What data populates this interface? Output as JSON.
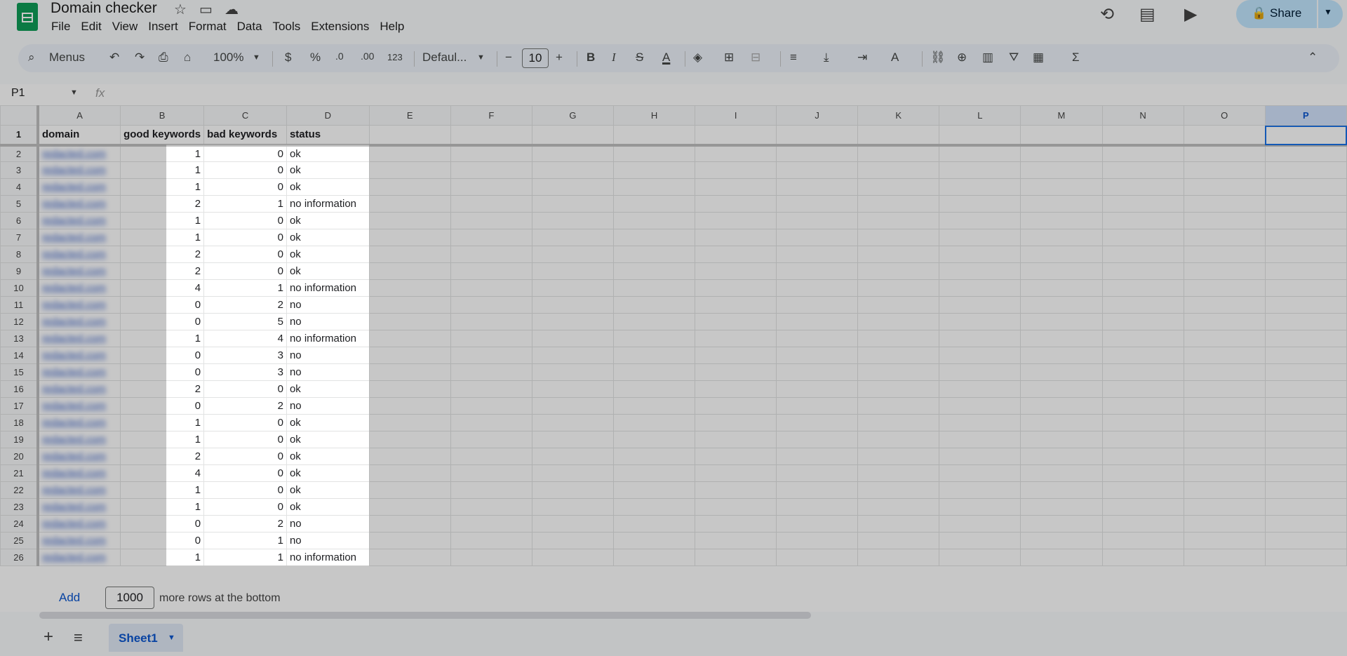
{
  "doc": {
    "title": "Domain checker",
    "star_icon": "star-icon",
    "move_icon": "folder-move-icon",
    "cloud_icon": "cloud-status-icon"
  },
  "menu": [
    "File",
    "Edit",
    "View",
    "Insert",
    "Format",
    "Data",
    "Tools",
    "Extensions",
    "Help"
  ],
  "header_right": {
    "history_icon": "history-icon",
    "comments_icon": "comments-icon",
    "meet_icon": "video-call-icon",
    "share_label": "Share"
  },
  "toolbar": {
    "search_label": "Menus",
    "zoom": "100%",
    "currency": "$",
    "percent": "%",
    "dec_decrease": ".0",
    "dec_increase": ".00",
    "number_format": "123",
    "font": "Defaul...",
    "font_size": "10",
    "bold": "B",
    "italic": "I",
    "strike": "S",
    "text_color": "A",
    "sum": "Σ"
  },
  "formula_bar": {
    "name_box": "P1",
    "fx": "fx"
  },
  "columns": [
    "A",
    "B",
    "C",
    "D",
    "E",
    "F",
    "G",
    "H",
    "I",
    "J",
    "K",
    "L",
    "M",
    "N",
    "O",
    "P"
  ],
  "selected_column": "P",
  "header_row": {
    "row_number": "1",
    "domain": "domain",
    "good_keywords": "good keywords",
    "bad_keywords": "bad keywords",
    "status": "status"
  },
  "rows": [
    {
      "n": "2",
      "domain": "redacted.com",
      "good": "1",
      "bad": "0",
      "status": "ok"
    },
    {
      "n": "3",
      "domain": "redacted.com",
      "good": "1",
      "bad": "0",
      "status": "ok"
    },
    {
      "n": "4",
      "domain": "redacted.com",
      "good": "1",
      "bad": "0",
      "status": "ok"
    },
    {
      "n": "5",
      "domain": "redacted.com",
      "good": "2",
      "bad": "1",
      "status": "no information"
    },
    {
      "n": "6",
      "domain": "redacted.com",
      "good": "1",
      "bad": "0",
      "status": "ok"
    },
    {
      "n": "7",
      "domain": "redacted.com",
      "good": "1",
      "bad": "0",
      "status": "ok"
    },
    {
      "n": "8",
      "domain": "redacted.com",
      "good": "2",
      "bad": "0",
      "status": "ok"
    },
    {
      "n": "9",
      "domain": "redacted.com",
      "good": "2",
      "bad": "0",
      "status": "ok"
    },
    {
      "n": "10",
      "domain": "redacted.com",
      "good": "4",
      "bad": "1",
      "status": "no information"
    },
    {
      "n": "11",
      "domain": "redacted.com",
      "good": "0",
      "bad": "2",
      "status": "no"
    },
    {
      "n": "12",
      "domain": "redacted.com",
      "good": "0",
      "bad": "5",
      "status": "no"
    },
    {
      "n": "13",
      "domain": "redacted.com",
      "good": "1",
      "bad": "4",
      "status": "no information"
    },
    {
      "n": "14",
      "domain": "redacted.com",
      "good": "0",
      "bad": "3",
      "status": "no"
    },
    {
      "n": "15",
      "domain": "redacted.com",
      "good": "0",
      "bad": "3",
      "status": "no"
    },
    {
      "n": "16",
      "domain": "redacted.com",
      "good": "2",
      "bad": "0",
      "status": "ok"
    },
    {
      "n": "17",
      "domain": "redacted.com",
      "good": "0",
      "bad": "2",
      "status": "no"
    },
    {
      "n": "18",
      "domain": "redacted.com",
      "good": "1",
      "bad": "0",
      "status": "ok"
    },
    {
      "n": "19",
      "domain": "redacted.com",
      "good": "1",
      "bad": "0",
      "status": "ok"
    },
    {
      "n": "20",
      "domain": "redacted.com",
      "good": "2",
      "bad": "0",
      "status": "ok"
    },
    {
      "n": "21",
      "domain": "redacted.com",
      "good": "4",
      "bad": "0",
      "status": "ok"
    },
    {
      "n": "22",
      "domain": "redacted.com",
      "good": "1",
      "bad": "0",
      "status": "ok"
    },
    {
      "n": "23",
      "domain": "redacted.com",
      "good": "1",
      "bad": "0",
      "status": "ok"
    },
    {
      "n": "24",
      "domain": "redacted.com",
      "good": "0",
      "bad": "2",
      "status": "no"
    },
    {
      "n": "25",
      "domain": "redacted.com",
      "good": "0",
      "bad": "1",
      "status": "no"
    },
    {
      "n": "26",
      "domain": "redacted.com",
      "good": "1",
      "bad": "1",
      "status": "no information"
    }
  ],
  "bottom": {
    "add_label": "Add",
    "rows_count": "1000",
    "rows_text": "more rows at the bottom",
    "sheet_tab": "Sheet1"
  },
  "colors": {
    "accent": "#0b57d0",
    "share_bg": "#c2e7ff",
    "sheets_green": "#0f9d58",
    "dim_overlay": "rgba(0,0,0,0.22)"
  }
}
